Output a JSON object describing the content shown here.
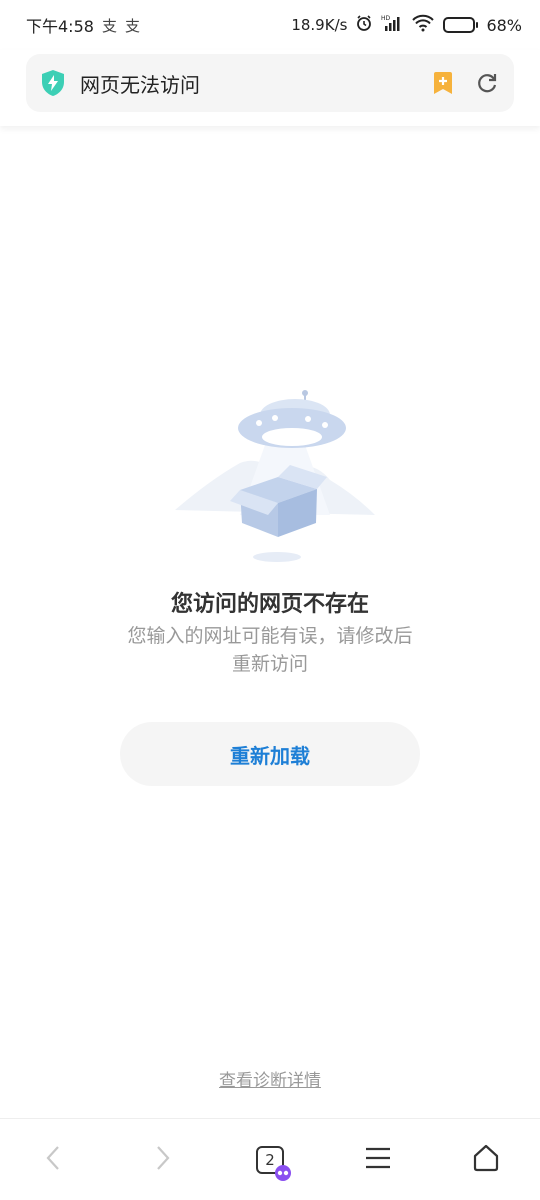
{
  "status_bar": {
    "time": "下午4:58",
    "notif_glyphs": [
      "支",
      "支"
    ],
    "net_speed": "18.9K/s",
    "battery": "68%",
    "battery_level": 0.68
  },
  "address_bar": {
    "title": "网页无法访问"
  },
  "error": {
    "title": "您访问的网页不存在",
    "subtitle_line1": "您输入的网址可能有误，请修改后",
    "subtitle_line2": "重新访问",
    "reload_label": "重新加载",
    "diagnostics_link": "查看诊断详情"
  },
  "bottom_nav": {
    "tab_count": "2"
  },
  "colors": {
    "accent": "#1e7fd6",
    "shield": "#3ccfb5",
    "bookmark": "#f6b23c",
    "incognito": "#8a4ff0"
  }
}
